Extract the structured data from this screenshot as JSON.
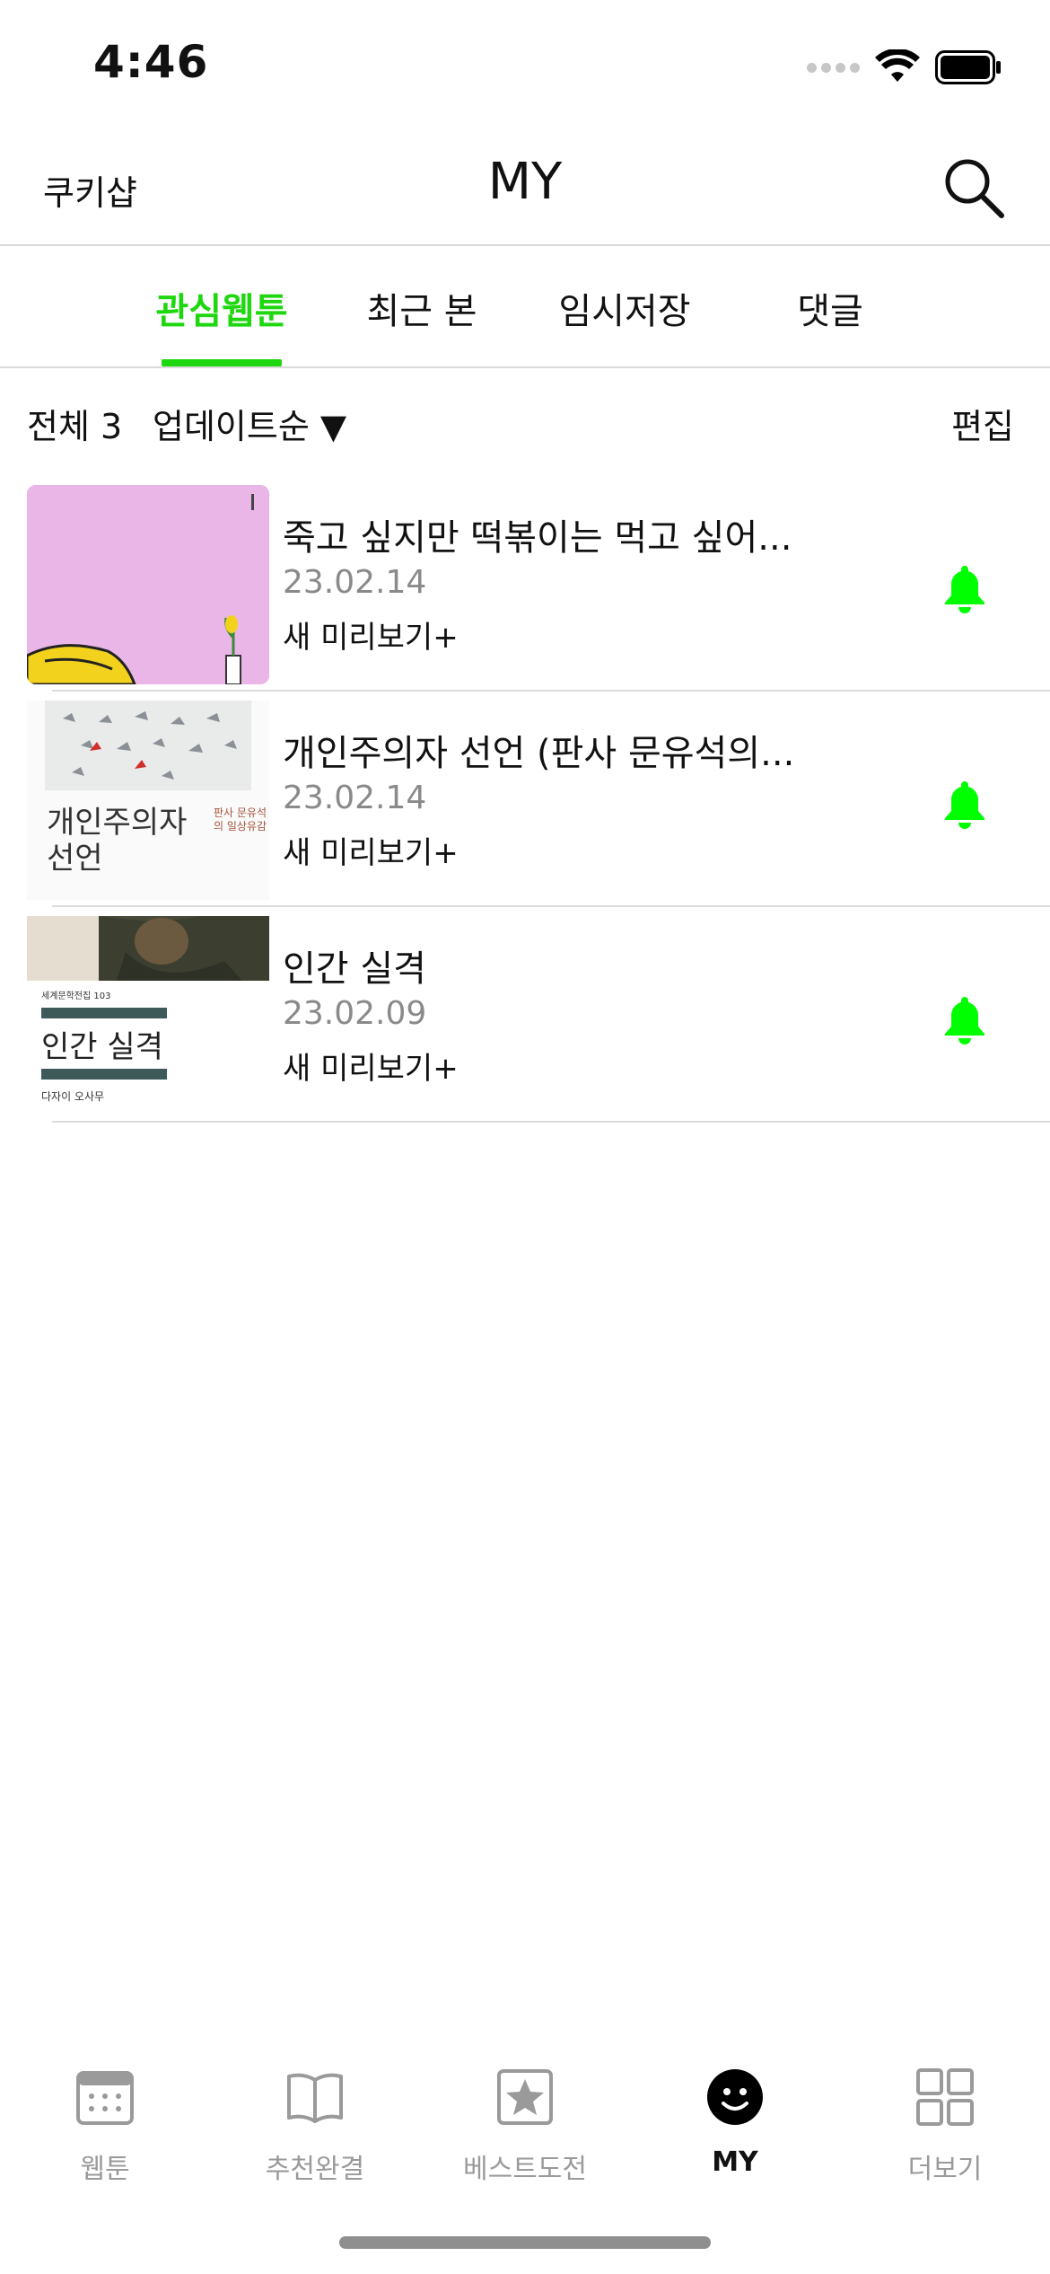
{
  "status": {
    "time": "4:46"
  },
  "nav": {
    "left": "쿠키샵",
    "title": "MY"
  },
  "tabs": [
    {
      "label": "관심웹툰"
    },
    {
      "label": "최근 본"
    },
    {
      "label": "임시저장"
    },
    {
      "label": "댓글"
    }
  ],
  "filter": {
    "total": "전체 3",
    "sort": "업데이트순 ▼",
    "edit": "편집"
  },
  "items": [
    {
      "title": "죽고 싶지만 떡볶이는 먹고 싶어...",
      "date": "23.02.14",
      "sub": "새 미리보기+"
    },
    {
      "title": "개인주의자 선언 (판사 문유석의...",
      "date": "23.02.14",
      "sub": "새 미리보기+",
      "cover_text": "개인주의자\n선언",
      "cover_tag": "판사 문유석의 일상유감"
    },
    {
      "title": "인간 실격",
      "date": "23.02.09",
      "sub": "새 미리보기+",
      "cover_text": "인간 실격",
      "cover_author": "다자이 오사무",
      "cover_series": "세계문학전집 103"
    }
  ],
  "tabbar": [
    {
      "label": "웹툰",
      "icon": "calendar-icon"
    },
    {
      "label": "추천완결",
      "icon": "book-icon"
    },
    {
      "label": "베스트도전",
      "icon": "star-icon"
    },
    {
      "label": "MY",
      "icon": "smiley-icon"
    },
    {
      "label": "더보기",
      "icon": "grid-icon"
    }
  ],
  "colors": {
    "accent": "#1ed70f",
    "bell": "#00ff00"
  }
}
